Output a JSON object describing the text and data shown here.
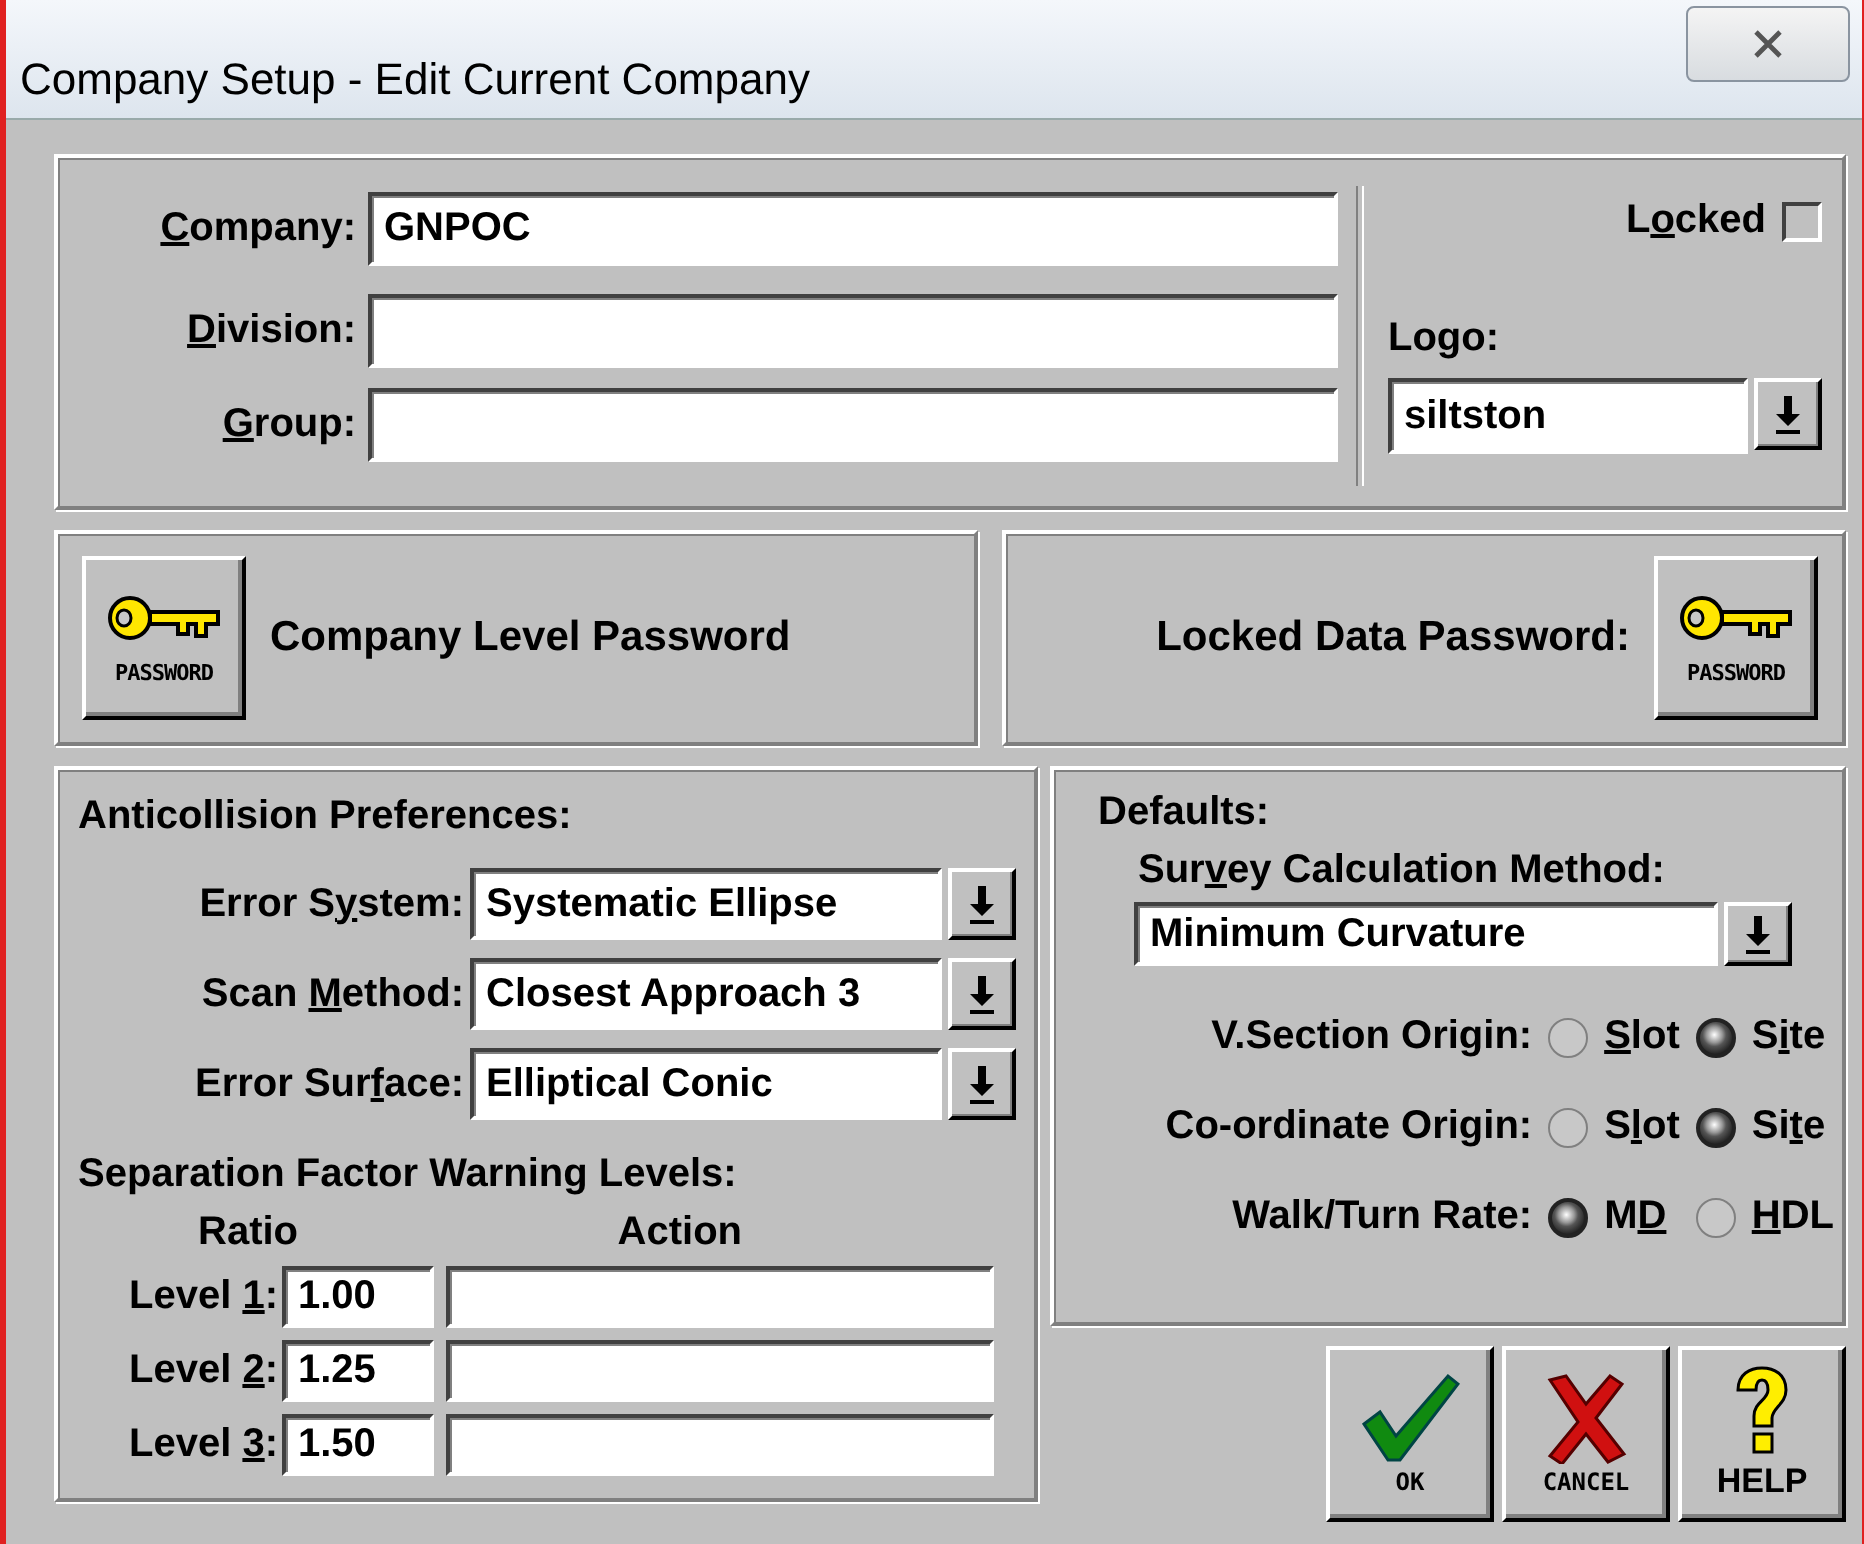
{
  "window": {
    "title": "Company Setup - Edit Current Company"
  },
  "company": {
    "fields": [
      {
        "label": {
          "key": "C",
          "after": "ompany:"
        },
        "value": "GNPOC"
      },
      {
        "label": {
          "key": "D",
          "after": "ivision:"
        }
      },
      {
        "label": {
          "key": "G",
          "after": "roup:"
        }
      }
    ],
    "locked": {
      "label": {
        "before": "L",
        "key": "o",
        "after": "cked"
      },
      "checked": false
    },
    "logo": {
      "label": "Logo:",
      "value": "siltston"
    }
  },
  "passwords": [
    {
      "kind": "icon_first",
      "label": "Company Level Password",
      "icon_caption": "PASSWORD"
    },
    {
      "kind": "label_first",
      "label": "Locked Data Password:",
      "icon_caption": "PASSWORD"
    }
  ],
  "anticollision": {
    "title": "Anticollision Preferences:",
    "dropdowns": [
      {
        "label": {
          "before": "Error S",
          "key": "y",
          "after": "stem:"
        },
        "value": "Systematic Ellipse"
      },
      {
        "label": {
          "before": "Scan ",
          "key": "M",
          "after": "ethod:"
        },
        "value": "Closest Approach 3"
      },
      {
        "label": {
          "before": "Error Sur",
          "key": "f",
          "after": "ace:"
        },
        "value": "Elliptical Conic"
      }
    ],
    "warning_title": "Separation Factor Warning Levels:",
    "columns": [
      "Ratio",
      "Action"
    ],
    "levels": [
      {
        "label": {
          "before": "Level ",
          "key": "1",
          "after": ":"
        },
        "ratio": "1.00"
      },
      {
        "label": {
          "before": "Level ",
          "key": "2",
          "after": ":"
        },
        "ratio": "1.25"
      },
      {
        "label": {
          "before": "Level ",
          "key": "3",
          "after": ":"
        },
        "ratio": "1.50"
      }
    ]
  },
  "defaults": {
    "title": "Defaults:",
    "survey_label": {
      "before": "Sur",
      "key": "v",
      "after": "ey Calculation Method:"
    },
    "survey_value": "Minimum Curvature",
    "radio_groups": [
      {
        "label": "V.Section Origin:",
        "options": [
          {
            "label": {
              "key": "S",
              "after": "lot"
            },
            "selected": false
          },
          {
            "label": {
              "before": "S",
              "key": "i",
              "after": "te"
            },
            "selected": true
          }
        ]
      },
      {
        "label": "Co-ordinate Origin:",
        "options": [
          {
            "label": {
              "before": "S",
              "key": "l",
              "after": "ot"
            },
            "selected": false
          },
          {
            "label": {
              "before": "Si",
              "key": "t",
              "after": "e"
            },
            "selected": true
          }
        ]
      },
      {
        "label": "Walk/Turn Rate:",
        "options": [
          {
            "label": {
              "before": "M",
              "key": "D"
            },
            "selected": true
          },
          {
            "label": {
              "key": "H",
              "after": "DL"
            },
            "selected": false
          }
        ]
      }
    ]
  },
  "buttons": [
    {
      "kind": "ok",
      "caption": "OK"
    },
    {
      "kind": "cancel",
      "caption": "CANCEL"
    },
    {
      "kind": "help",
      "caption": "HELP"
    }
  ]
}
